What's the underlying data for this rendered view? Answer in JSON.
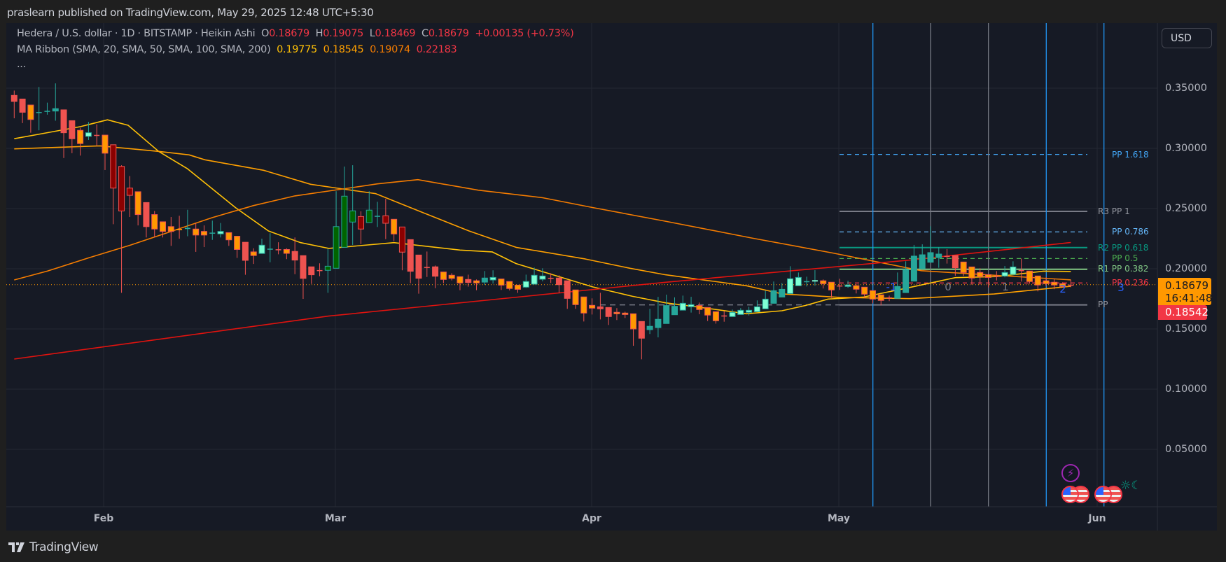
{
  "publish_line": "praslearn published on TradingView.com, May 29, 2025 12:48 UTC+5:30",
  "legend": {
    "symbol": "Hedera / U.S. dollar · 1D · BITSTAMP · Heikin Ashi",
    "o_label": "O",
    "o_value": "0.18679",
    "h_label": "H",
    "h_value": "0.19075",
    "l_label": "L",
    "l_value": "0.18469",
    "c_label": "C",
    "c_value": "0.18679",
    "change": "+0.00135 (+0.73%)",
    "ma_title": "MA Ribbon (SMA, 20, SMA, 50, SMA, 100, SMA, 200)",
    "ma_values": [
      "0.19775",
      "0.18545",
      "0.19074",
      "0.22183"
    ],
    "more": "..."
  },
  "currency_button": "USD",
  "price_axis": [
    "0.35000",
    "0.30000",
    "0.25000",
    "0.20000",
    "0.15000",
    "0.10000",
    "0.05000"
  ],
  "time_axis": [
    "Feb",
    "Mar",
    "Apr",
    "May",
    "Jun"
  ],
  "price_tags": {
    "last_price": "0.18679",
    "countdown": "16:41:48",
    "secondary_price": "0.18542"
  },
  "pivot_labels": [
    "PP 1.618",
    "R3 PP 1",
    "PP 0.786",
    "R2 PP 0.618",
    "PP 0.5",
    "R1 PP 0.382",
    "PP 0.236",
    "PP"
  ],
  "fib_time_labels": [
    "-1",
    "0",
    "1",
    "2",
    "3"
  ],
  "event_icons": [
    "lightning-icon",
    "us-flag-icon",
    "us-flag-icon",
    "us-flag-icon",
    "us-flag-icon",
    "sun-moon-icon"
  ],
  "footer_brand": "TradingView",
  "colors": {
    "bg": "#161a25",
    "grid": "#242833",
    "up_teal": "#26a69a",
    "up_mint": "#7fffd4",
    "up_green": "#006400",
    "down_red": "#ef5350",
    "down_orange": "#ff9800",
    "down_dark": "#8b0000",
    "sma20": "#ffc107",
    "sma50": "#ffa000",
    "sma100": "#f57c00",
    "sma200": "#e0130f"
  },
  "chart_data": {
    "type": "candlestick",
    "title": "Hedera / U.S. dollar · 1D · BITSTAMP · Heikin Ashi",
    "ylim": [
      0.0,
      0.36
    ],
    "y_ticks": [
      0.35,
      0.3,
      0.25,
      0.2,
      0.15,
      0.1,
      0.05
    ],
    "x_ticks": [
      "Feb",
      "Mar",
      "Apr",
      "May",
      "Jun"
    ],
    "grid": true,
    "candle_fields": [
      "open",
      "high",
      "low",
      "close",
      "style"
    ],
    "candles": [
      [
        0.344,
        0.348,
        0.325,
        0.339,
        "r"
      ],
      [
        0.341,
        0.341,
        0.321,
        0.33,
        "r"
      ],
      [
        0.336,
        0.336,
        0.313,
        0.324,
        "o"
      ],
      [
        0.33,
        0.351,
        0.315,
        0.3302,
        "t"
      ],
      [
        0.331,
        0.338,
        0.328,
        0.3312,
        "t"
      ],
      [
        0.331,
        0.354,
        0.323,
        0.333,
        "t"
      ],
      [
        0.332,
        0.332,
        0.292,
        0.313,
        "r"
      ],
      [
        0.323,
        0.323,
        0.296,
        0.308,
        "r"
      ],
      [
        0.315,
        0.317,
        0.294,
        0.304,
        "o"
      ],
      [
        0.31,
        0.322,
        0.307,
        0.313,
        "m"
      ],
      [
        0.3112,
        0.32,
        0.302,
        0.311,
        "r"
      ],
      [
        0.311,
        0.311,
        0.282,
        0.296,
        "o"
      ],
      [
        0.303,
        0.303,
        0.237,
        0.267,
        "d"
      ],
      [
        0.285,
        0.286,
        0.18,
        0.248,
        "d"
      ],
      [
        0.267,
        0.277,
        0.243,
        0.261,
        "d"
      ],
      [
        0.264,
        0.264,
        0.236,
        0.245,
        "o"
      ],
      [
        0.255,
        0.255,
        0.226,
        0.235,
        "r"
      ],
      [
        0.245,
        0.248,
        0.226,
        0.233,
        "o"
      ],
      [
        0.239,
        0.239,
        0.226,
        0.231,
        "o"
      ],
      [
        0.235,
        0.243,
        0.219,
        0.231,
        "o"
      ],
      [
        0.233,
        0.244,
        0.225,
        0.232,
        "o"
      ],
      [
        0.233,
        0.249,
        0.227,
        0.234,
        "t"
      ],
      [
        0.233,
        0.238,
        0.214,
        0.228,
        "o"
      ],
      [
        0.231,
        0.236,
        0.218,
        0.228,
        "o"
      ],
      [
        0.2298,
        0.24,
        0.224,
        0.23,
        "t"
      ],
      [
        0.229,
        0.238,
        0.226,
        0.231,
        "m"
      ],
      [
        0.23,
        0.23,
        0.219,
        0.224,
        "o"
      ],
      [
        0.227,
        0.227,
        0.209,
        0.216,
        "o"
      ],
      [
        0.222,
        0.222,
        0.195,
        0.207,
        "r"
      ],
      [
        0.214,
        0.217,
        0.204,
        0.211,
        "o"
      ],
      [
        0.2127,
        0.225,
        0.2127,
        0.2196,
        "m"
      ],
      [
        0.2165,
        0.2295,
        0.2054,
        0.2167,
        "t"
      ],
      [
        0.2162,
        0.222,
        0.212,
        0.216,
        "r"
      ],
      [
        0.216,
        0.217,
        0.208,
        0.2128,
        "o"
      ],
      [
        0.2144,
        0.226,
        0.1955,
        0.2072,
        "r"
      ],
      [
        0.2109,
        0.2109,
        0.175,
        0.192,
        "r"
      ],
      [
        0.2016,
        0.2016,
        0.1874,
        0.195,
        "r"
      ],
      [
        0.1989,
        0.2045,
        0.1938,
        0.1987,
        "r"
      ],
      [
        0.1987,
        0.2165,
        0.18,
        0.2021,
        "g"
      ],
      [
        0.2004,
        0.2644,
        0.2004,
        0.235,
        "g"
      ],
      [
        0.2178,
        0.2849,
        0.2178,
        0.2603,
        "g"
      ],
      [
        0.2388,
        0.286,
        0.2198,
        0.2481,
        "g"
      ],
      [
        0.2434,
        0.2477,
        0.2205,
        0.233,
        "d"
      ],
      [
        0.2384,
        0.2644,
        0.2384,
        0.2487,
        "g"
      ],
      [
        0.2438,
        0.2556,
        0.2347,
        0.244,
        "t"
      ],
      [
        0.244,
        0.2581,
        0.2246,
        0.2378,
        "d"
      ],
      [
        0.2411,
        0.2411,
        0.223,
        0.2289,
        "o"
      ],
      [
        0.2347,
        0.2347,
        0.1987,
        0.2138,
        "d"
      ],
      [
        0.2242,
        0.2242,
        0.188,
        0.1979,
        "r"
      ],
      [
        0.2114,
        0.2114,
        0.1793,
        0.1921,
        "r"
      ],
      [
        0.2015,
        0.2143,
        0.1932,
        0.2013,
        "r"
      ],
      [
        0.2016,
        0.2027,
        0.1839,
        0.1938,
        "r"
      ],
      [
        0.1973,
        0.1973,
        0.188,
        0.1911,
        "o"
      ],
      [
        0.1946,
        0.1963,
        0.1903,
        0.192,
        "o"
      ],
      [
        0.1934,
        0.1934,
        0.1822,
        0.1882,
        "o"
      ],
      [
        0.1911,
        0.1951,
        0.1851,
        0.1886,
        "r"
      ],
      [
        0.19,
        0.1911,
        0.1822,
        0.1882,
        "o"
      ],
      [
        0.1889,
        0.1981,
        0.1866,
        0.1923,
        "t"
      ],
      [
        0.1907,
        0.1987,
        0.1877,
        0.1928,
        "m"
      ],
      [
        0.1915,
        0.1915,
        0.1824,
        0.1864,
        "o"
      ],
      [
        0.1894,
        0.1894,
        0.182,
        0.1836,
        "o"
      ],
      [
        0.1864,
        0.1864,
        0.18,
        0.1829,
        "o"
      ],
      [
        0.1847,
        0.1951,
        0.1841,
        0.1894,
        "m"
      ],
      [
        0.1872,
        0.201,
        0.1872,
        0.1946,
        "m"
      ],
      [
        0.1913,
        0.2004,
        0.1895,
        0.194,
        "m"
      ],
      [
        0.1925,
        0.1963,
        0.1882,
        0.1923,
        "r"
      ],
      [
        0.1923,
        0.1946,
        0.18,
        0.1868,
        "r"
      ],
      [
        0.19,
        0.19,
        0.1667,
        0.1754,
        "r"
      ],
      [
        0.1824,
        0.1824,
        0.1667,
        0.1702,
        "o"
      ],
      [
        0.1766,
        0.1766,
        0.1562,
        0.1632,
        "o"
      ],
      [
        0.1696,
        0.1754,
        0.162,
        0.1673,
        "o"
      ],
      [
        0.1684,
        0.18,
        0.1579,
        0.1667,
        "r"
      ],
      [
        0.1678,
        0.1678,
        0.1533,
        0.1603,
        "r"
      ],
      [
        0.1638,
        0.1673,
        0.1574,
        0.1626,
        "o"
      ],
      [
        0.1632,
        0.1643,
        0.1591,
        0.162,
        "o"
      ],
      [
        0.1626,
        0.1626,
        0.136,
        0.15,
        "o"
      ],
      [
        0.1562,
        0.1562,
        0.1248,
        0.1423,
        "r"
      ],
      [
        0.1494,
        0.1667,
        0.1458,
        0.1522,
        "t"
      ],
      [
        0.1511,
        0.1766,
        0.143,
        0.158,
        "t"
      ],
      [
        0.1545,
        0.1785,
        0.1545,
        0.1694,
        "t"
      ],
      [
        0.1618,
        0.1762,
        0.1618,
        0.1688,
        "t"
      ],
      [
        0.1656,
        0.1777,
        0.1656,
        0.1713,
        "m"
      ],
      [
        0.1685,
        0.1767,
        0.1636,
        0.1702,
        "m"
      ],
      [
        0.1694,
        0.1719,
        0.1622,
        0.1661,
        "o"
      ],
      [
        0.1678,
        0.1678,
        0.1566,
        0.1615,
        "o"
      ],
      [
        0.1643,
        0.1643,
        0.1544,
        0.1568,
        "o"
      ],
      [
        0.1612,
        0.1649,
        0.156,
        0.161,
        "r"
      ],
      [
        0.1603,
        0.1661,
        0.1603,
        0.1638,
        "m"
      ],
      [
        0.162,
        0.1673,
        0.162,
        0.1655,
        "m"
      ],
      [
        0.1638,
        0.1684,
        0.1612,
        0.1655,
        "m"
      ],
      [
        0.1643,
        0.1737,
        0.1643,
        0.1684,
        "m"
      ],
      [
        0.1667,
        0.1818,
        0.1667,
        0.1748,
        "m"
      ],
      [
        0.1713,
        0.1894,
        0.1713,
        0.1818,
        "t"
      ],
      [
        0.1765,
        0.1882,
        0.1765,
        0.1829,
        "t"
      ],
      [
        0.1794,
        0.2021,
        0.1794,
        0.1917,
        "m"
      ],
      [
        0.1859,
        0.1969,
        0.1859,
        0.1928,
        "m"
      ],
      [
        0.1895,
        0.1934,
        0.1853,
        0.1897,
        "t"
      ],
      [
        0.1894,
        0.1988,
        0.1859,
        0.1905,
        "m"
      ],
      [
        0.19,
        0.1911,
        0.1836,
        0.1876,
        "o"
      ],
      [
        0.1888,
        0.1888,
        0.1758,
        0.1824,
        "o"
      ],
      [
        0.1861,
        0.1917,
        0.1824,
        0.1859,
        "r"
      ],
      [
        0.1853,
        0.19,
        0.1842,
        0.1865,
        "m"
      ],
      [
        0.1859,
        0.1871,
        0.1795,
        0.183,
        "o"
      ],
      [
        0.1847,
        0.1847,
        0.176,
        0.1789,
        "o"
      ],
      [
        0.1818,
        0.1818,
        0.1713,
        0.1748,
        "o"
      ],
      [
        0.1783,
        0.1783,
        0.1696,
        0.1737,
        "o"
      ],
      [
        0.1762,
        0.1777,
        0.1731,
        0.176,
        "r"
      ],
      [
        0.1754,
        0.1969,
        0.1754,
        0.1853,
        "t"
      ],
      [
        0.1802,
        0.2062,
        0.1802,
        0.1992,
        "t"
      ],
      [
        0.1897,
        0.2198,
        0.1897,
        0.2105,
        "t"
      ],
      [
        0.2002,
        0.2203,
        0.2002,
        0.2116,
        "t"
      ],
      [
        0.2054,
        0.2353,
        0.2054,
        0.2134,
        "t"
      ],
      [
        0.2093,
        0.218,
        0.2008,
        0.2122,
        "t"
      ],
      [
        0.2107,
        0.2163,
        0.2043,
        0.2105,
        "r"
      ],
      [
        0.211,
        0.211,
        0.1942,
        0.2008,
        "r"
      ],
      [
        0.2056,
        0.2056,
        0.194,
        0.1969,
        "o"
      ],
      [
        0.2015,
        0.2015,
        0.1868,
        0.1923,
        "o"
      ],
      [
        0.1969,
        0.2004,
        0.1868,
        0.1934,
        "o"
      ],
      [
        0.1951,
        0.1951,
        0.1845,
        0.1928,
        "o"
      ],
      [
        0.1942,
        0.198,
        0.1903,
        0.194,
        "r"
      ],
      [
        0.194,
        0.2023,
        0.1929,
        0.1969,
        "m"
      ],
      [
        0.1953,
        0.2062,
        0.1953,
        0.2015,
        "m"
      ],
      [
        0.1989,
        0.2085,
        0.1894,
        0.1987,
        "r"
      ],
      [
        0.1981,
        0.1981,
        0.1876,
        0.1894,
        "o"
      ],
      [
        0.194,
        0.194,
        0.1812,
        0.1865,
        "o"
      ],
      [
        0.19,
        0.193,
        0.1855,
        0.1876,
        "o"
      ],
      [
        0.1888,
        0.1917,
        0.183,
        0.1865,
        "o"
      ],
      [
        0.1876,
        0.1888,
        0.1847,
        0.1853,
        "o"
      ],
      [
        0.18679,
        0.19075,
        0.18469,
        0.18679,
        "r"
      ]
    ],
    "moving_averages": [
      {
        "name": "SMA 20",
        "points": [
          [
            1,
            0.308
          ],
          [
            5,
            0.313
          ],
          [
            9,
            0.318
          ],
          [
            12.3,
            0.3237
          ],
          [
            14.8,
            0.3192
          ],
          [
            18.5,
            0.2975
          ],
          [
            22,
            0.283
          ],
          [
            27.8,
            0.2508
          ],
          [
            31.8,
            0.2314
          ],
          [
            35.7,
            0.2217
          ],
          [
            39.1,
            0.2169
          ],
          [
            47,
            0.2217
          ],
          [
            55,
            0.2155
          ],
          [
            58.9,
            0.214
          ],
          [
            61.8,
            0.2043
          ],
          [
            71.1,
            0.1849
          ],
          [
            75.9,
            0.1771
          ],
          [
            79.9,
            0.1717
          ],
          [
            84,
            0.168
          ],
          [
            89.7,
            0.1626
          ],
          [
            94,
            0.1651
          ],
          [
            96.8,
            0.1694
          ],
          [
            99.6,
            0.1748
          ],
          [
            103.9,
            0.1765
          ],
          [
            109.5,
            0.1845
          ],
          [
            115,
            0.1926
          ],
          [
            120,
            0.1935
          ],
          [
            125.7,
            0.198
          ],
          [
            129,
            0.19775
          ]
        ]
      },
      {
        "name": "SMA 50",
        "points": [
          [
            1,
            0.2996
          ],
          [
            11.4,
            0.3021
          ],
          [
            18.5,
            0.2975
          ],
          [
            22.2,
            0.2946
          ],
          [
            24.1,
            0.2905
          ],
          [
            31.2,
            0.2818
          ],
          [
            36.9,
            0.2702
          ],
          [
            40.8,
            0.2663
          ],
          [
            44.8,
            0.2624
          ],
          [
            50.4,
            0.2469
          ],
          [
            56.1,
            0.2314
          ],
          [
            61.8,
            0.2178
          ],
          [
            70.2,
            0.2081
          ],
          [
            75.6,
            0.2004
          ],
          [
            79.9,
            0.195
          ],
          [
            89.7,
            0.1859
          ],
          [
            94,
            0.1791
          ],
          [
            101,
            0.1762
          ],
          [
            109.5,
            0.1752
          ],
          [
            119.7,
            0.179
          ],
          [
            129,
            0.18545
          ]
        ]
      },
      {
        "name": "SMA 100",
        "points": [
          [
            1,
            0.1907
          ],
          [
            5,
            0.198
          ],
          [
            10,
            0.209
          ],
          [
            15,
            0.2195
          ],
          [
            20,
            0.231
          ],
          [
            25,
            0.2425
          ],
          [
            30,
            0.2525
          ],
          [
            35,
            0.2605
          ],
          [
            40.8,
            0.2663
          ],
          [
            45,
            0.2705
          ],
          [
            49.9,
            0.274
          ],
          [
            57.2,
            0.2653
          ],
          [
            65,
            0.259
          ],
          [
            71.1,
            0.2508
          ],
          [
            79.9,
            0.2395
          ],
          [
            90.3,
            0.2256
          ],
          [
            100.2,
            0.213
          ],
          [
            110.9,
            0.1984
          ],
          [
            120,
            0.1945
          ],
          [
            129,
            0.19074
          ]
        ]
      },
      {
        "name": "SMA 200",
        "points": [
          [
            1,
            0.125
          ],
          [
            39.1,
            0.1607
          ],
          [
            79.9,
            0.1888
          ],
          [
            109.5,
            0.2072
          ],
          [
            129,
            0.22183
          ]
        ]
      }
    ],
    "pivot_levels": [
      {
        "label": "PP 1.618",
        "value": 0.295,
        "style": "dashed",
        "color": "#42a5f5"
      },
      {
        "label": "R3 PP 1",
        "value": 0.2477,
        "style": "solid",
        "color": "#787b86"
      },
      {
        "label": "PP 0.786",
        "value": 0.2306,
        "style": "dashed",
        "color": "#64b5f6"
      },
      {
        "label": "R2 PP 0.618",
        "value": 0.2176,
        "style": "solid",
        "color": "#089981"
      },
      {
        "label": "PP 0.5",
        "value": 0.2085,
        "style": "dashed",
        "color": "#4caf50"
      },
      {
        "label": "R1 PP 0.382",
        "value": 0.1996,
        "style": "solid",
        "color": "#81c784"
      },
      {
        "label": "PP 0.236",
        "value": 0.1882,
        "style": "dashed",
        "color": "#f23645"
      },
      {
        "label": "PP",
        "value": 0.17,
        "style": "solid",
        "color": "#787b86"
      }
    ],
    "previous_pp": 0.17,
    "last_price": 0.18679
  }
}
